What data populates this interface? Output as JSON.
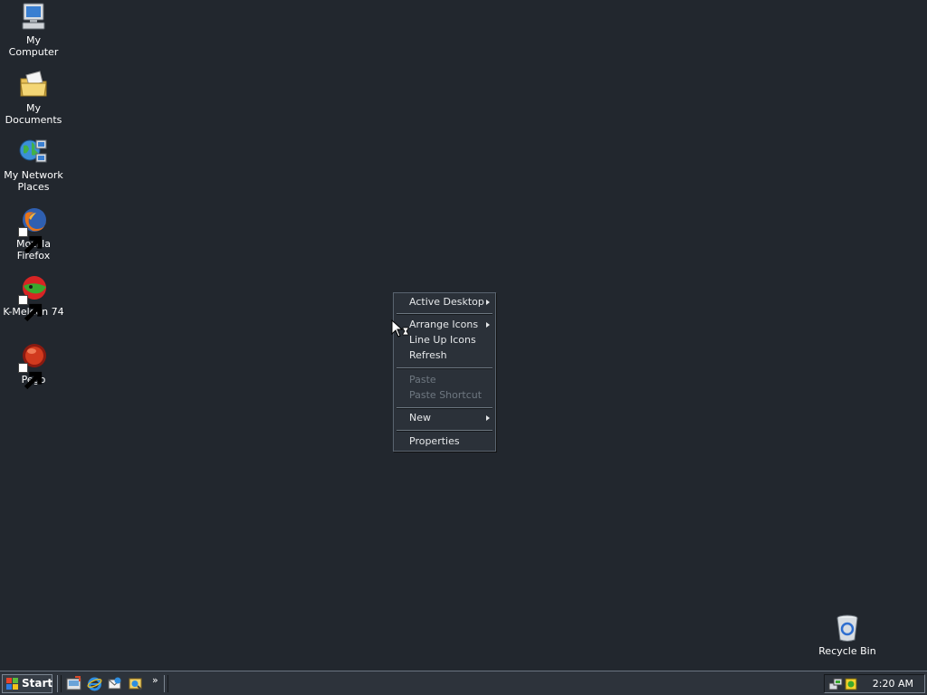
{
  "desktop": {
    "icons": [
      {
        "label": "My Computer",
        "icon": "computer-icon"
      },
      {
        "label": "My Documents",
        "icon": "folder-icon"
      },
      {
        "label": "My Network Places",
        "icon": "network-icon"
      },
      {
        "label": "Mozilla Firefox",
        "icon": "firefox-icon"
      },
      {
        "label": "K-Meleon 74",
        "icon": "kmeleon-icon"
      },
      {
        "label": "Pego",
        "icon": "pego-icon"
      },
      {
        "label": "Recycle Bin",
        "icon": "recycle-bin-icon"
      }
    ]
  },
  "context_menu": {
    "items": [
      {
        "label": "Active Desktop",
        "submenu": true,
        "enabled": true
      },
      {
        "label": "Arrange Icons",
        "submenu": true,
        "enabled": true
      },
      {
        "label": "Line Up Icons",
        "submenu": false,
        "enabled": true
      },
      {
        "label": "Refresh",
        "submenu": false,
        "enabled": true
      },
      {
        "label": "Paste",
        "submenu": false,
        "enabled": false
      },
      {
        "label": "Paste Shortcut",
        "submenu": false,
        "enabled": false
      },
      {
        "label": "New",
        "submenu": true,
        "enabled": true
      },
      {
        "label": "Properties",
        "submenu": false,
        "enabled": true
      }
    ]
  },
  "taskbar": {
    "start_label": "Start",
    "quick_launch": [
      "show-desktop-icon",
      "internet-explorer-icon",
      "outlook-express-icon",
      "media-player-icon"
    ],
    "overflow": "»",
    "tray_icons": [
      "network-tray-icon",
      "security-tray-icon"
    ],
    "clock": "2:20 AM"
  },
  "colors": {
    "desktop_background": "#22272e",
    "menu_background": "#2b3139",
    "taskbar_background": "#2d333b"
  }
}
